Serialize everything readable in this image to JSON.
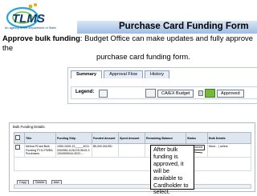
{
  "logo": {
    "text": "TLMS",
    "tagline": "An agency of the Department of State"
  },
  "title": "Purchase Card Funding Form",
  "caption": {
    "bold": "Approve bulk funding",
    "rest_line1": ": Budget Office can make updates and fully approve the",
    "rest_line2": "purchase card funding form."
  },
  "tabs": [
    {
      "label": "Summary",
      "active": true
    },
    {
      "label": "Approval Flow",
      "active": false
    },
    {
      "label": "History",
      "active": false
    }
  ],
  "legend": {
    "label": "Legend:",
    "items": [
      "Pending",
      "CA/EX Budget",
      "Approved"
    ]
  },
  "details": {
    "title": "Bulk Funding Details:",
    "columns": [
      "",
      "Title",
      "Funding Strip",
      "Funded Amount",
      "Spent Amount",
      "Remaining Balance",
      "Status",
      "Bulk Details"
    ],
    "row": {
      "title": "Melina PCard Bulk Funding FY11 PMRA Purchases",
      "strip": "1950-2009-19_____401120009M-1128-DS-5615-31004909044-3022---",
      "funded": "$5,000.00USD",
      "status": "Approved",
      "bulk": "More... | select"
    },
    "buttons": [
      "Copy",
      "Delete",
      "Add"
    ]
  },
  "callout": "After bulk funding is approved, it will be available to Cardholder to select.",
  "colors": {
    "title_bar": "#9fbde3",
    "approved_indicator": "#76b83c",
    "logo_blue": "#0b3a73"
  }
}
